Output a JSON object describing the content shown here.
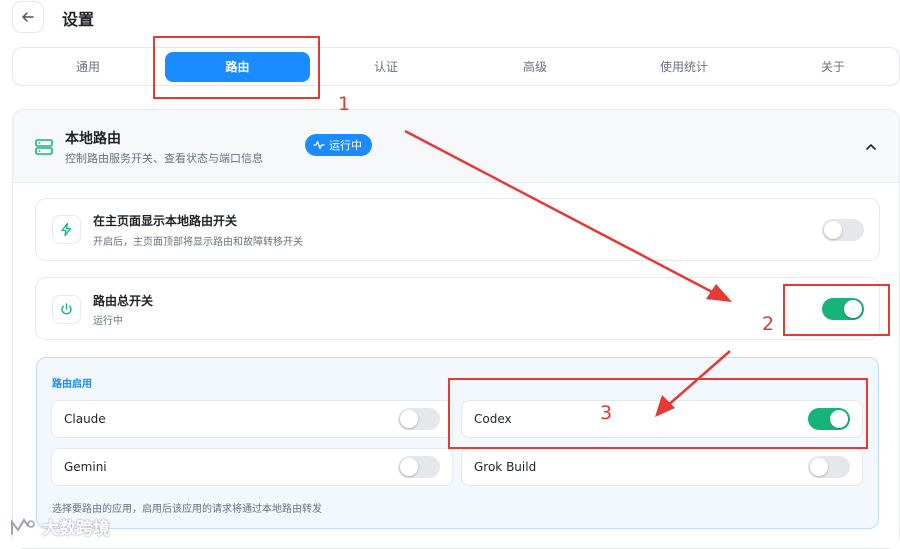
{
  "header": {
    "title": "设置"
  },
  "tabs": [
    {
      "label": "通用"
    },
    {
      "label": "路由"
    },
    {
      "label": "认证"
    },
    {
      "label": "高级"
    },
    {
      "label": "使用统计"
    },
    {
      "label": "关于"
    }
  ],
  "section": {
    "title": "本地路由",
    "subtitle": "控制路由服务开关、查看状态与端口信息",
    "status": "运行中",
    "icon": "server-icon"
  },
  "cards": {
    "show_toggle": {
      "title": "在主页面显示本地路由开关",
      "subtitle": "开启后，主页面顶部将显示路由和故障转移开关",
      "enabled": false,
      "icon": "lightning-icon"
    },
    "master_switch": {
      "title": "路由总开关",
      "subtitle": "运行中",
      "enabled": true,
      "icon": "power-icon"
    }
  },
  "apps": {
    "title": "路由启用",
    "items": [
      {
        "name": "Claude",
        "enabled": false
      },
      {
        "name": "Codex",
        "enabled": true
      },
      {
        "name": "Gemini",
        "enabled": false
      },
      {
        "name": "Grok Build",
        "enabled": false
      }
    ],
    "note": "选择要路由的应用，启用后该应用的请求将通过本地路由转发"
  },
  "annotations": {
    "one": "1",
    "two": "2",
    "three": "3"
  },
  "watermark": "大数跨境",
  "colors": {
    "accent": "#1a8cff",
    "toggle_on": "#16b47a",
    "annotation": "#e53935"
  }
}
